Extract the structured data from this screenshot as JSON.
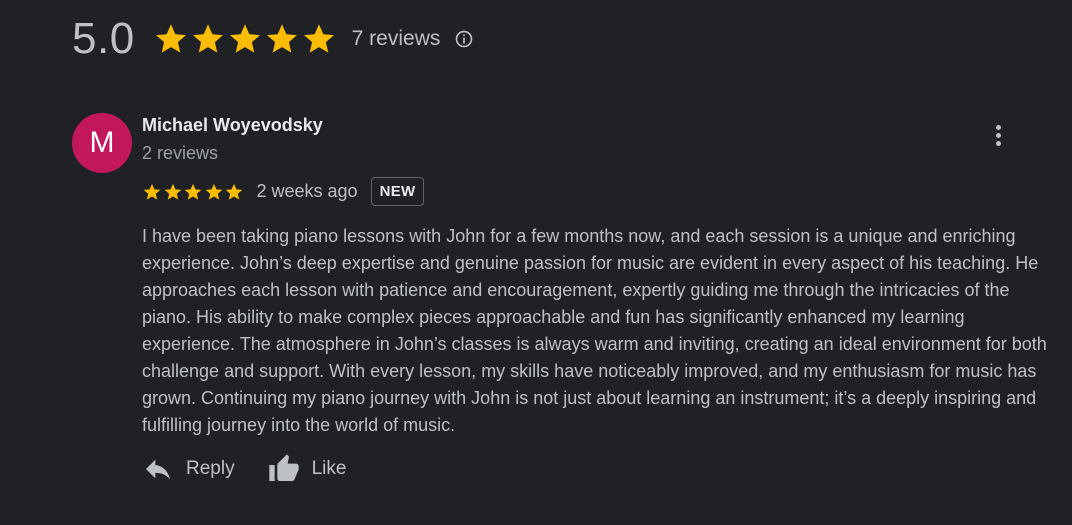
{
  "summary": {
    "score": "5.0",
    "rating": 5,
    "review_count": "7 reviews",
    "star_color": "#fbbc04"
  },
  "review": {
    "avatar_letter": "M",
    "avatar_color": "#c2185b",
    "author": "Michael Woyevodsky",
    "author_reviews": "2 reviews",
    "rating": 5,
    "time": "2 weeks ago",
    "badge": "NEW",
    "text": "I have been taking piano lessons with John for a few months now, and each session is a unique and enriching experience. John’s deep expertise and genuine passion for music are evident in every aspect of his teaching. He approaches each lesson with patience and encouragement, expertly guiding me through the intricacies of the piano. His ability to make complex pieces approachable and fun has significantly enhanced my learning experience. The atmosphere in John’s classes is always warm and inviting, creating an ideal environment for both challenge and support. With every lesson, my skills have noticeably improved, and my enthusiasm for music has grown. Continuing my piano journey with John is not just about learning an instrument; it’s a deeply inspiring and fulfilling journey into the world of music.",
    "actions": {
      "reply_label": "Reply",
      "like_label": "Like"
    },
    "icons": [
      "more-vert-icon",
      "reply-icon",
      "thumb-up-icon",
      "info-icon",
      "star-icon"
    ]
  }
}
